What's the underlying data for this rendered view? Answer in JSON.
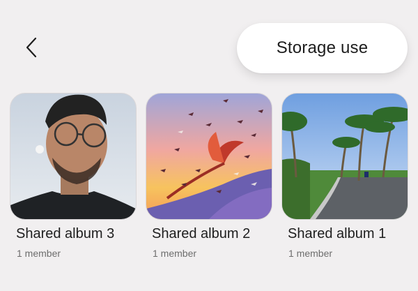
{
  "header": {
    "back_icon": "chevron-left-icon",
    "storage_button_label": "Storage use"
  },
  "albums": [
    {
      "title": "Shared album 3",
      "members": "1 member"
    },
    {
      "title": "Shared album 2",
      "members": "1 member"
    },
    {
      "title": "Shared album 1",
      "members": "1 member"
    }
  ],
  "colors": {
    "background": "#f1eff0",
    "button_bg": "#ffffff",
    "text_primary": "#1e1e1e",
    "text_secondary": "#6d6d6d"
  }
}
